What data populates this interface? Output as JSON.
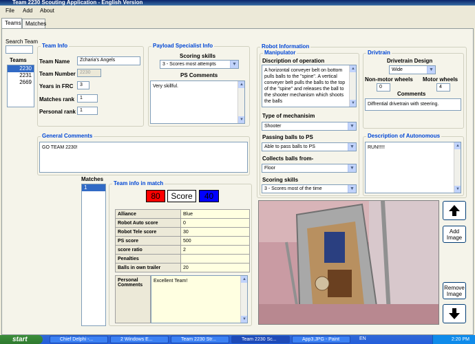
{
  "window": {
    "title": "Team 2230 Scouting Application - English Version"
  },
  "menu": [
    "File",
    "Add",
    "About"
  ],
  "tabs": [
    "Teams",
    "Matches"
  ],
  "search": {
    "label": "Search Team",
    "value": ""
  },
  "teams": {
    "label": "Teams",
    "items": [
      "2230",
      "2231",
      "2669"
    ],
    "selected": 0
  },
  "team_info": {
    "title": "Team Info",
    "name_label": "Team Name",
    "name_value": "Zcharia's Angels",
    "number_label": "Team Number",
    "number_value": "2230",
    "years_label": "Years in FRC",
    "years_value": "3",
    "matches_rank_label": "Matches rank",
    "matches_rank_value": "1",
    "personal_rank_label": "Personal rank",
    "personal_rank_value": "1"
  },
  "payload": {
    "title": "Payload Specialist Info",
    "scoring_label": "Scoring skills",
    "scoring_value": "3 - Scores most attempts",
    "comments_label": "PS Comments",
    "comments_value": "Very skillful."
  },
  "general": {
    "title": "General Comments",
    "value": "GO TEAM 2230!"
  },
  "robot": {
    "title": "Robot Information"
  },
  "manipulator": {
    "title": "Manipulator",
    "desc_label": "Discription of operation",
    "desc_value": "A horizontal conveyer belt on bottom pulls balls to the \"spine\". A vertical conveyer belt pulls the balls to the top of the \"spine\" and releases the ball to the shooter mechanism which shoots the balls",
    "type_label": "Type of mechanisim",
    "type_value": "Shooter",
    "passing_label": "Passing balls to PS",
    "passing_value": "Able to pass balls to PS",
    "collects_label": "Collects balls from-",
    "collects_value": "Floor",
    "scoring_label": "Scoring skills",
    "scoring_value": "3 - Scores most of the time"
  },
  "drivetrain": {
    "title": "Drivtrain",
    "design_label": "Drivetrain Design",
    "design_value": "Wide",
    "nonmotor_label": "Non-motor wheels",
    "nonmotor_value": "0",
    "motor_label": "Motor wheels",
    "motor_value": "4",
    "comments_label": "Comments",
    "comments_value": "Diffrential drivetrain with steering."
  },
  "autonomous": {
    "title": "Description of Autonomous",
    "value": "RUN!!!!!"
  },
  "matches": {
    "label": "Matches",
    "items": [
      "1"
    ],
    "selected": 0
  },
  "match_info": {
    "title": "Team info in match",
    "red_score": "80",
    "score_label": "Score",
    "blue_score": "40",
    "rows": [
      {
        "k": "Alliance",
        "v": "Blue"
      },
      {
        "k": "Robot Auto score",
        "v": "0"
      },
      {
        "k": "Robot Tele score",
        "v": "30"
      },
      {
        "k": "PS score",
        "v": "500"
      },
      {
        "k": "score ratio",
        "v": "2"
      },
      {
        "k": "Penalties",
        "v": ""
      },
      {
        "k": "Balls in own trailer",
        "v": "20"
      }
    ],
    "personal_label": "Personal Comments",
    "personal_value": "Excellent Team!"
  },
  "buttons": {
    "add_image": "Add Image",
    "remove_image": "Remove Image"
  },
  "taskbar": {
    "start": "start",
    "tasks": [
      "Chief Delphi -...",
      "2 Windows E...",
      "Team 2230 Str...",
      "Team 2230 Sc...",
      "App3.JPG - Paint"
    ],
    "lang": "EN",
    "clock": "2:20 PM"
  },
  "colors": {
    "red": "#ff0000",
    "blue": "#0000ff",
    "accent": "#0046d5"
  }
}
